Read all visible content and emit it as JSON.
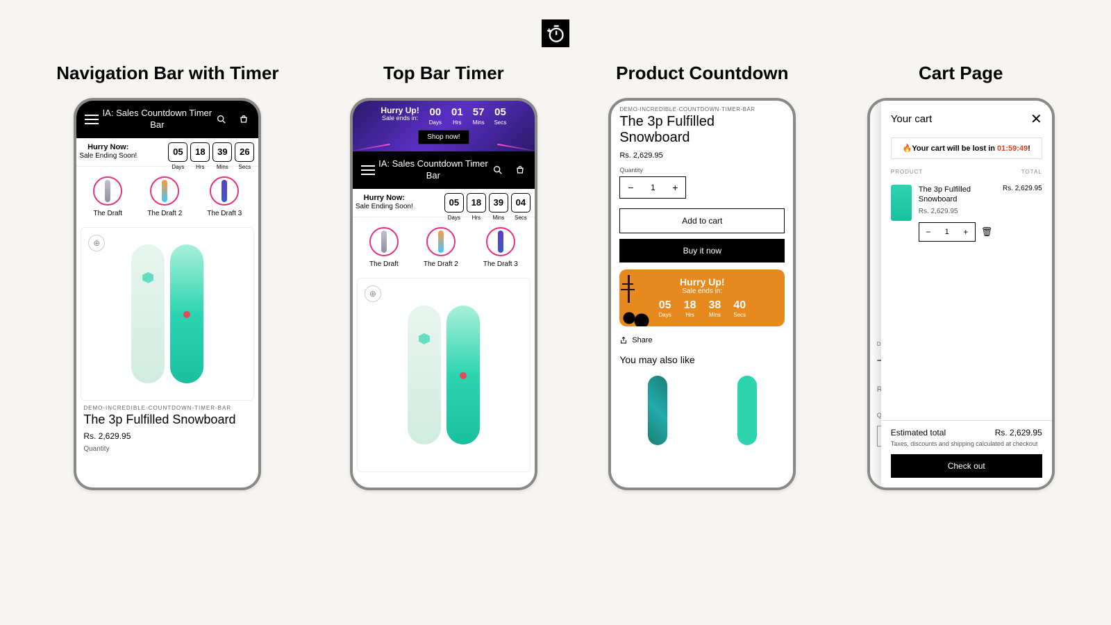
{
  "logo_alt": "stopwatch-icon",
  "panels": {
    "nav": {
      "title": "Navigation Bar with Timer",
      "app_title": "IA: Sales Countdown Timer Bar",
      "hurry_title": "Hurry Now:",
      "hurry_sub": "Sale Ending Soon!",
      "digits": {
        "days": "05",
        "hrs": "18",
        "mins": "39",
        "secs": "26"
      },
      "digit_labels": {
        "days": "Days",
        "hrs": "Hrs",
        "mins": "Mins",
        "secs": "Secs"
      },
      "drafts": [
        "The Draft",
        "The Draft 2",
        "The Draft 3"
      ],
      "vendor": "DEMO-INCREDIBLE-COUNTDOWN-TIMER-BAR",
      "product_title": "The 3p Fulfilled Snowboard",
      "price": "Rs. 2,629.95",
      "qty_label": "Quantity"
    },
    "topbar": {
      "title": "Top Bar  Timer",
      "purple_title": "Hurry Up!",
      "purple_sub": "Sale ends in:",
      "digits": {
        "days": "00",
        "hrs": "01",
        "mins": "57",
        "secs": "05"
      },
      "digit_labels": {
        "days": "Days",
        "hrs": "Hrs",
        "mins": "Mins",
        "secs": "Secs"
      },
      "shop_now": "Shop now!",
      "app_title": "IA: Sales Countdown Timer Bar",
      "hurry_title": "Hurry Now:",
      "hurry_sub": "Sale Ending Soon!",
      "digits2": {
        "days": "05",
        "hrs": "18",
        "mins": "39",
        "secs": "04"
      },
      "drafts": [
        "The Draft",
        "The Draft 2",
        "The Draft 3"
      ]
    },
    "product": {
      "title": "Product Countdown",
      "vendor": "DEMO-INCREDIBLE-COUNTDOWN-TIMER-BAR",
      "product_title": "The 3p Fulfilled Snowboard",
      "price": "Rs. 2,629.95",
      "qty_label": "Quantity",
      "qty_value": "1",
      "add_to_cart": "Add to cart",
      "buy_now": "Buy it now",
      "banner_title": "Hurry Up!",
      "banner_sub": "Sale ends in:",
      "digits": {
        "days": "05",
        "hrs": "18",
        "mins": "38",
        "secs": "40"
      },
      "digit_labels": {
        "days": "Days",
        "hrs": "Hrs",
        "mins": "Mins",
        "secs": "Secs"
      },
      "share": "Share",
      "also_like": "You may also like"
    },
    "cart": {
      "title": "Cart Page",
      "header": "Your cart",
      "lost_prefix": "🔥Your cart will be lost in ",
      "lost_time": "01:59:49",
      "lost_suffix": "!",
      "col_product": "PRODUCT",
      "col_total": "TOTAL",
      "item_name": "The 3p Fulfilled Snowboard",
      "item_price": "Rs. 2,629.95",
      "item_total": "Rs. 2,629.95",
      "qty_value": "1",
      "est_label": "Estimated total",
      "est_value": "Rs. 2,629.95",
      "tax_note": "Taxes, discounts and shipping calculated at checkout",
      "checkout": "Check out",
      "bg_peek_vendor": "DE",
      "bg_peek_title": "T",
      "bg_peek_price": "Rs",
      "bg_peek_qty": "Q"
    }
  }
}
